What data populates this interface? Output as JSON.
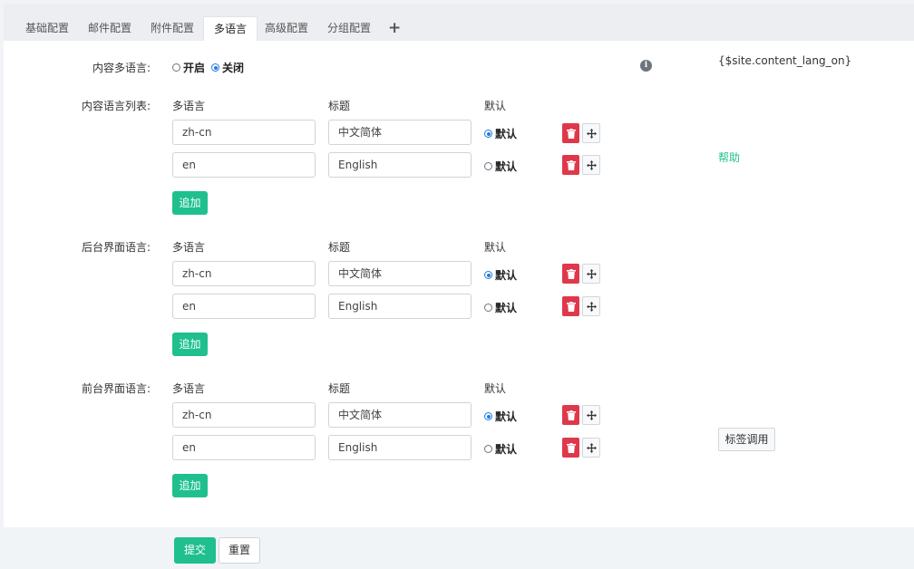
{
  "tabs": [
    "基础配置",
    "邮件配置",
    "附件配置",
    "多语言",
    "高级配置",
    "分组配置"
  ],
  "tab_add": "+",
  "content_lang": {
    "label": "内容多语言:",
    "options": [
      {
        "label": "开启",
        "checked": false
      },
      {
        "label": "关闭",
        "checked": true
      }
    ],
    "tag_hint": "{$site.content_lang_on}"
  },
  "columns": {
    "lang": "多语言",
    "title": "标题",
    "default": "默认"
  },
  "sections": [
    {
      "label": "内容语言列表:",
      "rows": [
        {
          "lang": "zh-cn",
          "title": "中文简体",
          "default_label": "默认",
          "is_default": true
        },
        {
          "lang": "en",
          "title": "English",
          "default_label": "默认",
          "is_default": false
        }
      ],
      "add_label": "追加"
    },
    {
      "label": "后台界面语言:",
      "rows": [
        {
          "lang": "zh-cn",
          "title": "中文简体",
          "default_label": "默认",
          "is_default": true
        },
        {
          "lang": "en",
          "title": "English",
          "default_label": "默认",
          "is_default": false
        }
      ],
      "add_label": "追加"
    },
    {
      "label": "前台界面语言:",
      "rows": [
        {
          "lang": "zh-cn",
          "title": "中文简体",
          "default_label": "默认",
          "is_default": true
        },
        {
          "lang": "en",
          "title": "English",
          "default_label": "默认",
          "is_default": false
        }
      ],
      "add_label": "追加"
    }
  ],
  "help_link": "帮助",
  "tag_button": "标签调用",
  "submit": "提交",
  "reset": "重置",
  "info_icon": "i",
  "colors": {
    "accent": "#1fc08e",
    "danger": "#e0384b",
    "radio": "#1f7ae0"
  }
}
